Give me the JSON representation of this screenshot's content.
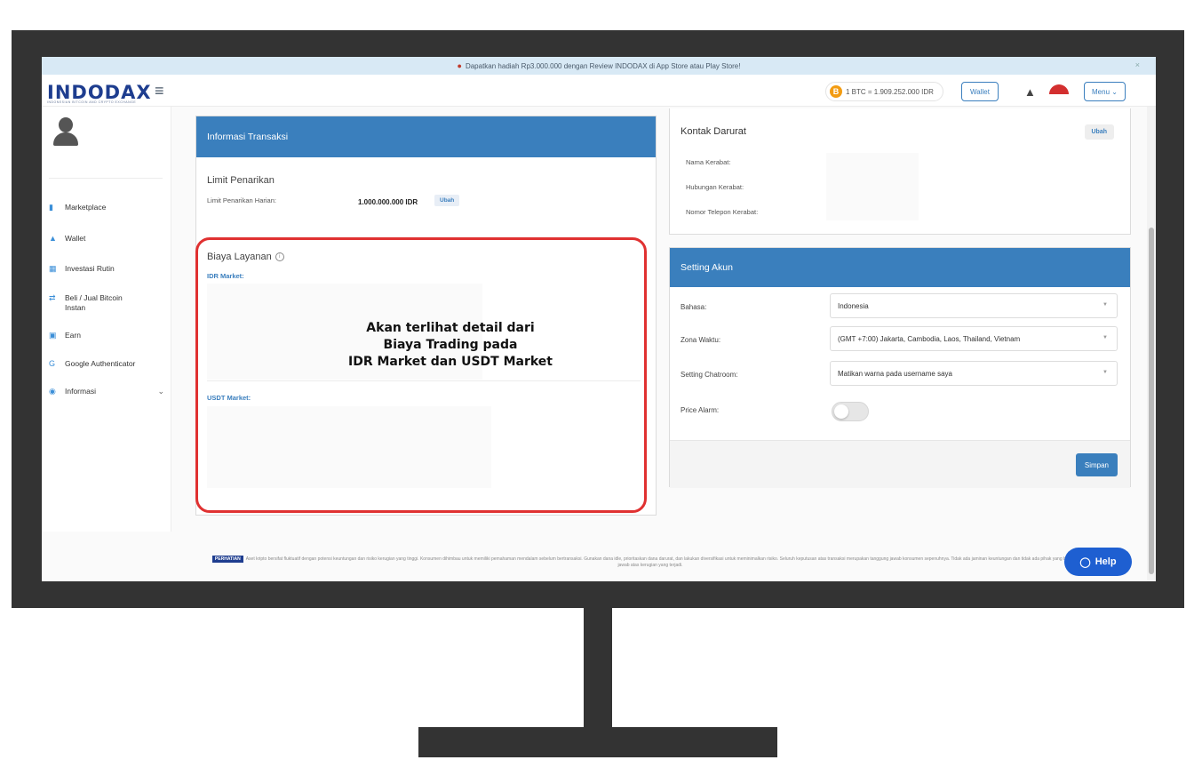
{
  "promo": {
    "text": "Dapatkan hadiah Rp3.000.000 dengan Review INDODAX di App Store atau Play Store!",
    "close": "×"
  },
  "header": {
    "logo": "INDODAX",
    "logo_tagline": "INDONESIAN BITCOIN AND CRYPTO EXCHANGE",
    "btc_price": "1 BTC = 1.909.252.000 IDR",
    "wallet_label": "Wallet",
    "menu_label": "Menu ⌄"
  },
  "sidebar": {
    "items": [
      {
        "label": "Marketplace",
        "icon": "chart-icon"
      },
      {
        "label": "Wallet",
        "icon": "wallet-icon"
      },
      {
        "label": "Investasi Rutin",
        "icon": "calendar-icon"
      },
      {
        "label": "Beli / Jual Bitcoin Instan",
        "icon": "swap-icon"
      },
      {
        "label": "Earn",
        "icon": "earn-icon"
      },
      {
        "label": "Google Authenticator",
        "icon": "google-icon"
      },
      {
        "label": "Informasi",
        "icon": "info-icon"
      }
    ]
  },
  "informasi_transaksi": {
    "title": "Informasi Transaksi",
    "limit_title": "Limit Penarikan",
    "limit_label": "Limit Penarikan Harian:",
    "limit_value": "1.000.000.000 IDR",
    "limit_ubah": "Ubah",
    "biaya_title": "Biaya Layanan",
    "idr_market": "IDR Market:",
    "usdt_market": "USDT Market:"
  },
  "callout": {
    "line1": "Akan terlihat detail dari",
    "line2": "Biaya Trading pada",
    "line3": "IDR Market dan USDT Market"
  },
  "kontak_darurat": {
    "title": "Kontak Darurat",
    "ubah": "Ubah",
    "nama": "Nama Kerabat:",
    "hubungan": "Hubungan Kerabat:",
    "telepon": "Nomor Telepon Kerabat:"
  },
  "setting_akun": {
    "title": "Setting Akun",
    "bahasa_label": "Bahasa:",
    "bahasa_value": "Indonesia",
    "zona_label": "Zona Waktu:",
    "zona_value": "(GMT +7:00) Jakarta, Cambodia, Laos, Thailand, Vietnam",
    "chatroom_label": "Setting Chatroom:",
    "chatroom_value": "Matikan warna pada username saya",
    "price_alarm_label": "Price Alarm:",
    "price_alarm_on": false,
    "simpan": "Simpan"
  },
  "footer": {
    "perhatian": "PERHATIAN",
    "text": "Aset kripto bersifat fluktuatif dengan potensi keuntungan dan risiko kerugian yang tinggi. Konsumen dihimbau untuk memiliki pemahaman mendalam sebelum bertransaksi. Gunakan dana idle, prioritaskan dana darurat, dan lakukan diversifikasi untuk meminimalkan risiko. Seluruh keputusan atas transaksi merupakan tanggung jawab konsumen sepenuhnya. Tidak ada jaminan keuntungan dan tidak ada pihak yang bertanggung jawab atas kerugian yang terjadi.",
    "help": "Help"
  },
  "colors": {
    "brand_blue": "#1e3d8f",
    "panel_blue": "#3a7fbd",
    "highlight_red": "#e03131",
    "btc_orange": "#f39c12"
  }
}
